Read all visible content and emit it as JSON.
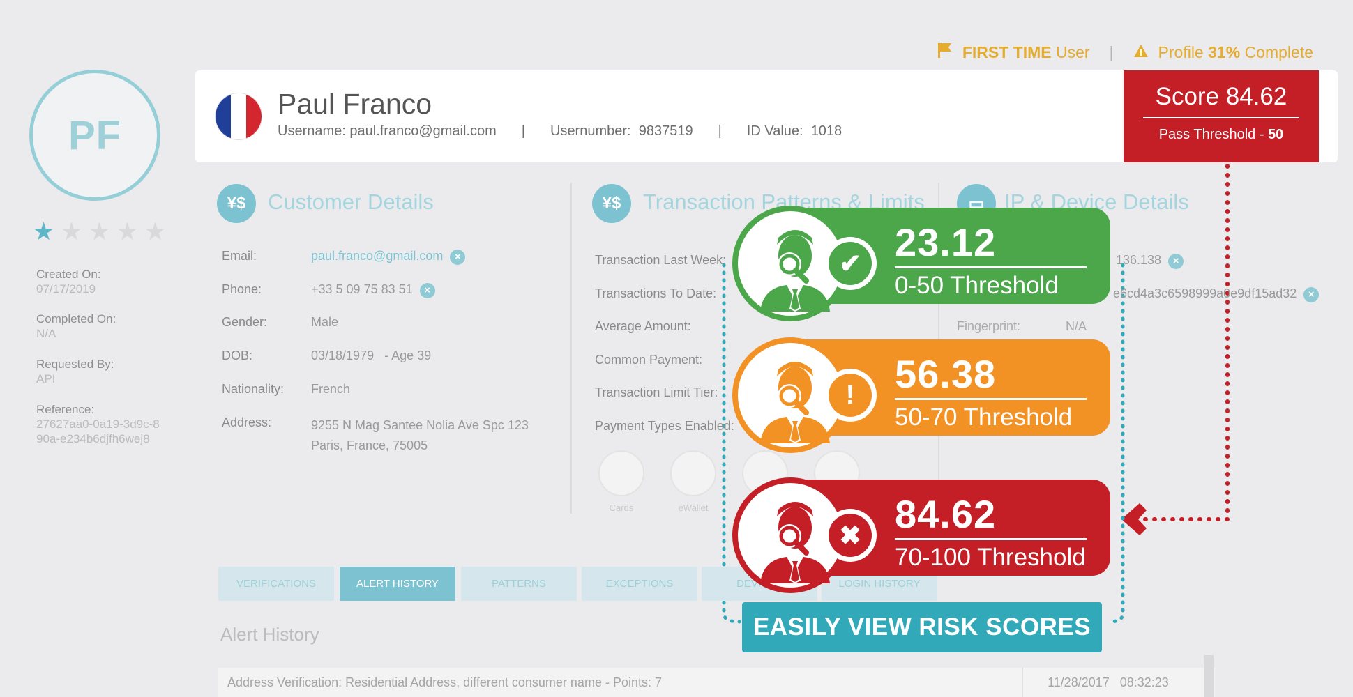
{
  "status": {
    "first_time_strong": "FIRST TIME",
    "first_time_rest": "User",
    "profile_prefix": "Profile",
    "profile_pct": "31%",
    "profile_suffix": "Complete"
  },
  "avatar": {
    "initials": "PF"
  },
  "rating": {
    "value": 1,
    "max": 5
  },
  "meta": [
    {
      "label": "Created On:",
      "value": "07/17/2019"
    },
    {
      "label": "Completed On:",
      "value": "N/A"
    },
    {
      "label": "Requested By:",
      "value": "API"
    },
    {
      "label": "Reference:",
      "value": "27627aa0-0a19-3d9c-8",
      "value2": "90a-e234b6djfh6wej8"
    }
  ],
  "header": {
    "name": "Paul Franco",
    "username_label": "Username:",
    "username": "paul.franco@gmail.com",
    "usernumber_label": "Usernumber:",
    "usernumber": "9837519",
    "idvalue_label": "ID Value:",
    "idvalue": "1018",
    "divider": "|",
    "flag_colors": [
      "#1f3f99",
      "#ffffff",
      "#d4262e"
    ]
  },
  "score": {
    "label": "Score 84.62",
    "threshold_label": "Pass Threshold -",
    "threshold_value": "50"
  },
  "customer": {
    "title": "Customer Details",
    "rows": [
      {
        "label": "Email:",
        "value": "paul.franco@gmail.com"
      },
      {
        "label": "Phone:",
        "value": "+33 5 09 75 83 51"
      },
      {
        "label": "Gender:",
        "value": "Male"
      },
      {
        "label": "DOB:",
        "value": "03/18/1979   - Age 39"
      },
      {
        "label": "Nationality:",
        "value": "French"
      },
      {
        "label": "Address:",
        "value": "9255 N Mag Santee Nolia Ave Spc 123",
        "value2": "Paris, France, 75005"
      }
    ]
  },
  "transactions": {
    "title": "Transaction Patterns & Limits",
    "rows": [
      "Transaction Last Week:",
      "Transactions To Date:",
      "Average Amount:",
      "Common Payment:",
      "Transaction Limit Tier:",
      "Payment Types Enabled:"
    ],
    "payments": [
      "Cards",
      "eWallet",
      "",
      ""
    ]
  },
  "ip": {
    "title": "IP & Device Details",
    "ip_partial": "136.138",
    "device_partial": "e6cd4a3c6598999a0e9df15ad32",
    "fingerprint_label": "Fingerprint:",
    "fingerprint_value": "N/A"
  },
  "tabs": [
    "VERIFICATIONS",
    "ALERT HISTORY",
    "PATTERNS",
    "EXCEPTIONS",
    "DEVICES",
    "LOGIN HISTORY"
  ],
  "active_tab": "ALERT HISTORY",
  "alert": {
    "title": "Alert History",
    "rows": [
      {
        "text": "Address Verification: Residential Address, different consumer name - Points: 7",
        "date": "11/28/2017   08:32:23"
      }
    ]
  },
  "risk_levels": [
    {
      "score": "23.12",
      "threshold": "0-50 Threshold",
      "color": "#4ca74b",
      "icon": "check-icon"
    },
    {
      "score": "56.38",
      "threshold": "50-70 Threshold",
      "color": "#f39224",
      "icon": "warning-icon"
    },
    {
      "score": "84.62",
      "threshold": "70-100 Threshold",
      "color": "#c41f26",
      "icon": "x-icon"
    }
  ],
  "cta": "EASILY VIEW RISK SCORES"
}
